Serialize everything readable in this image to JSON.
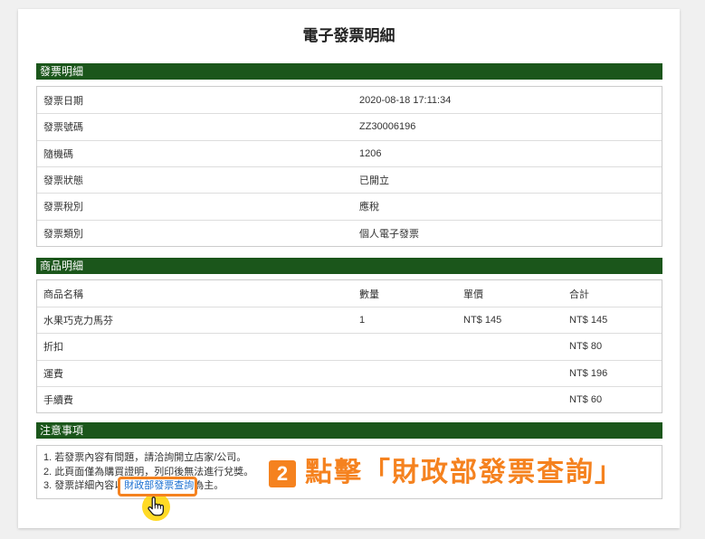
{
  "page": {
    "title": "電子發票明細"
  },
  "invoice_section": {
    "heading": "發票明細",
    "rows": [
      {
        "label": "發票日期",
        "value": "2020-08-18 17:11:34"
      },
      {
        "label": "發票號碼",
        "value": "ZZ30006196"
      },
      {
        "label": "隨機碼",
        "value": "1206"
      },
      {
        "label": "發票狀態",
        "value": "已開立"
      },
      {
        "label": "發票稅別",
        "value": "應稅"
      },
      {
        "label": "發票類別",
        "value": "個人電子發票"
      }
    ]
  },
  "items_section": {
    "heading": "商品明細",
    "columns": [
      "商品名稱",
      "數量",
      "單價",
      "合計"
    ],
    "rows": [
      [
        "水果巧克力馬芬",
        "1",
        "NT$ 145",
        "NT$ 145"
      ],
      [
        "折扣",
        "",
        "",
        "NT$ 80"
      ],
      [
        "運費",
        "",
        "",
        "NT$ 196"
      ],
      [
        "手續費",
        "",
        "",
        "NT$ 60"
      ]
    ]
  },
  "notes_section": {
    "heading": "注意事項",
    "notes": [
      "1. 若發票內容有問題，請洽詢開立店家/公司。",
      "2. 此頁面僅為購買證明，列印後無法進行兌獎。"
    ],
    "note3_prefix": "3. 發票詳細內容以",
    "note3_link": "財政部發票查詢",
    "note3_suffix": "為主。"
  },
  "annotation": {
    "step_number": "2",
    "instruction": "點擊「財政部發票查詢」"
  },
  "icons": {
    "cursor": "hand-pointer-icon"
  },
  "colors": {
    "page_background": "#f0f0f0",
    "section_header": "#1b561b",
    "annotation_orange": "#f5821f",
    "link": "#1a6fd1"
  }
}
